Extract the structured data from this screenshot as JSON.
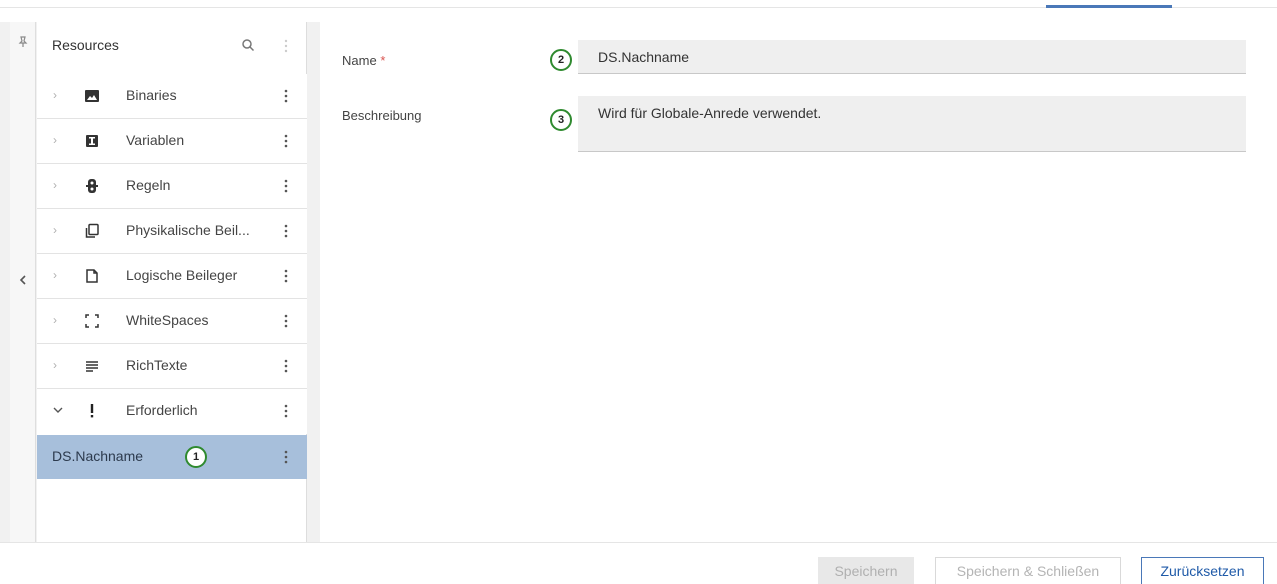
{
  "sidebar": {
    "title": "Resources",
    "items": [
      {
        "label": "Binaries",
        "icon": "image-icon"
      },
      {
        "label": "Variablen",
        "icon": "variable-icon"
      },
      {
        "label": "Regeln",
        "icon": "rules-icon"
      },
      {
        "label": "Physikalische Beil...",
        "icon": "copy-icon"
      },
      {
        "label": "Logische Beileger",
        "icon": "document-icon"
      },
      {
        "label": "WhiteSpaces",
        "icon": "whitespace-icon"
      },
      {
        "label": "RichTexte",
        "icon": "lines-icon"
      },
      {
        "label": "Erforderlich",
        "icon": "exclamation-icon"
      }
    ],
    "selected": {
      "label": "DS.Nachname"
    }
  },
  "form": {
    "name_label": "Name",
    "required_mark": "*",
    "name_value": "DS.Nachname",
    "description_label": "Beschreibung",
    "description_value": "Wird für Globale-Anrede verwendet."
  },
  "badges": {
    "one": "1",
    "two": "2",
    "three": "3"
  },
  "footer": {
    "save_label": "Speichern",
    "save_close_label": "Speichern & Schließen",
    "reset_label": "Zurücksetzen"
  },
  "colors": {
    "accent": "#4a78b8",
    "selection": "#a7bfdb",
    "badge_ring": "#2f8a2f",
    "required": "#d9534f"
  }
}
